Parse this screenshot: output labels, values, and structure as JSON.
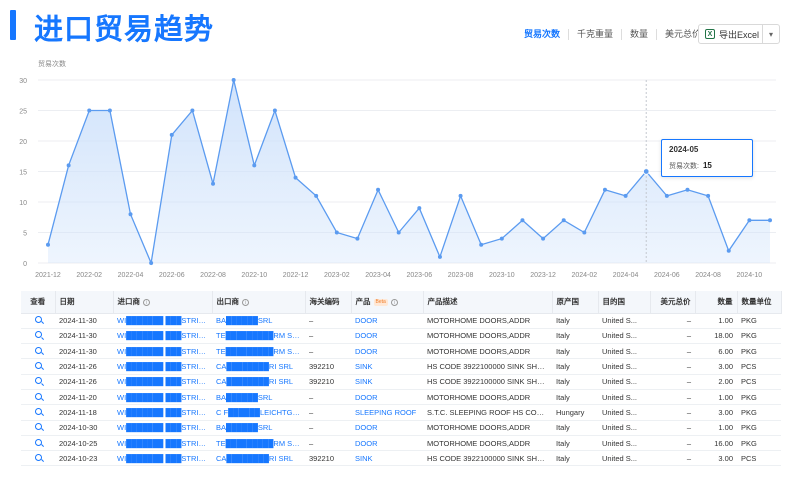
{
  "page": {
    "title": "进口贸易趋势"
  },
  "toolbar": {
    "tabs": [
      {
        "label": "贸易次数",
        "active": true
      },
      {
        "label": "千克重量",
        "active": false
      },
      {
        "label": "数量",
        "active": false
      },
      {
        "label": "美元总价",
        "active": false
      }
    ],
    "export_label": "导出Excel",
    "export_icon": "excel-icon",
    "caret_icon": "chevron-down-icon"
  },
  "chart_data": {
    "type": "area",
    "ylabel": "贸易次数",
    "ylim": [
      0,
      30
    ],
    "yticks": [
      0,
      5,
      10,
      15,
      20,
      25,
      30
    ],
    "x": [
      "2021-12",
      "2022-01",
      "2022-02",
      "2022-03",
      "2022-04",
      "2022-05",
      "2022-06",
      "2022-07",
      "2022-08",
      "2022-09",
      "2022-10",
      "2022-11",
      "2022-12",
      "2023-01",
      "2023-02",
      "2023-03",
      "2023-04",
      "2023-05",
      "2023-06",
      "2023-07",
      "2023-08",
      "2023-09",
      "2023-10",
      "2023-11",
      "2023-12",
      "2024-01",
      "2024-02",
      "2024-03",
      "2024-04",
      "2024-05",
      "2024-06",
      "2024-07",
      "2024-08",
      "2024-09",
      "2024-10",
      "2024-11"
    ],
    "values": [
      3,
      16,
      25,
      25,
      8,
      0,
      21,
      25,
      13,
      30,
      16,
      25,
      14,
      11,
      5,
      4,
      12,
      5,
      9,
      1,
      11,
      3,
      4,
      7,
      4,
      7,
      5,
      12,
      11,
      15,
      11,
      12,
      11,
      2,
      7,
      7
    ],
    "xtick_labels": [
      "2021-12",
      "2022-02",
      "2022-04",
      "2022-06",
      "2022-08",
      "2022-10",
      "2022-12",
      "2023-02",
      "2023-04",
      "2023-06",
      "2023-08",
      "2023-10",
      "2023-12",
      "2024-02",
      "2024-04",
      "2024-06",
      "2024-08",
      "2024-10"
    ],
    "grid": true,
    "color": "#5b9bf0",
    "fill": "#cfe2fb",
    "highlight_index": 29
  },
  "tooltip": {
    "title": "2024-05",
    "label": "贸易次数:",
    "value": "15"
  },
  "table": {
    "headers": [
      "查看",
      "日期",
      "进口商",
      "出口商",
      "海关编码",
      "产品",
      "产品描述",
      "原产国",
      "目的国",
      "美元总价",
      "数量",
      "数量单位"
    ],
    "beta_label": "Beta",
    "rows": [
      [
        "",
        "2024-11-30",
        "WI███████ ███STRIES",
        "BA██████SRL",
        "–",
        "DOOR",
        "MOTORHOME DOORS,ADDR",
        "Italy",
        "United S...",
        "–",
        "1.00",
        "PKG"
      ],
      [
        "",
        "2024-11-30",
        "WI███████ ███STRIES",
        "TE█████████RM SPA",
        "–",
        "DOOR",
        "MOTORHOME DOORS,ADDR",
        "Italy",
        "United S...",
        "–",
        "18.00",
        "PKG"
      ],
      [
        "",
        "2024-11-30",
        "WI███████ ███STRIES",
        "TE█████████RM SPA",
        "–",
        "DOOR",
        "MOTORHOME DOORS,ADDR",
        "Italy",
        "United S...",
        "–",
        "6.00",
        "PKG"
      ],
      [
        "",
        "2024-11-26",
        "WI███████ ███STRIES...",
        "CA████████RI SRL",
        "392210",
        "SINK",
        "HS CODE 3922100000 SINK SHOWE",
        "Italy",
        "United S...",
        "–",
        "3.00",
        "PCS"
      ],
      [
        "",
        "2024-11-26",
        "WI███████ ███STRIES",
        "CA████████RI SRL",
        "392210",
        "SINK",
        "HS CODE 3922100000 SINK SHOWE",
        "Italy",
        "United S...",
        "–",
        "2.00",
        "PCS"
      ],
      [
        "",
        "2024-11-20",
        "WI███████ ███STRIES",
        "BA██████SRL",
        "–",
        "DOOR",
        "MOTORHOME DOORS,ADDR",
        "Italy",
        "United S...",
        "–",
        "1.00",
        "PKG"
      ],
      [
        "",
        "2024-11-18",
        "WI███████ ███STRIES",
        "C F██████LEICHTGU...",
        "–",
        "SLEEPING ROOF",
        "S.T.C. SLEEPING ROOF HS CODE 87",
        "Hungary",
        "United S...",
        "–",
        "3.00",
        "PKG"
      ],
      [
        "",
        "2024-10-30",
        "WI███████ ███STRIES",
        "BA██████SRL",
        "–",
        "DOOR",
        "MOTORHOME DOORS,ADDR",
        "Italy",
        "United S...",
        "–",
        "1.00",
        "PKG"
      ],
      [
        "",
        "2024-10-25",
        "WI███████ ███STRIES",
        "TE█████████RM SPA",
        "–",
        "DOOR",
        "MOTORHOME DOORS,ADDR",
        "Italy",
        "United S...",
        "–",
        "16.00",
        "PKG"
      ],
      [
        "",
        "2024-10-23",
        "WI███████ ███STRIES...",
        "CA████████RI SRL",
        "392210",
        "SINK",
        "HS CODE 3922100000 SINK SHOWE",
        "Italy",
        "United S...",
        "–",
        "3.00",
        "PCS"
      ]
    ]
  }
}
